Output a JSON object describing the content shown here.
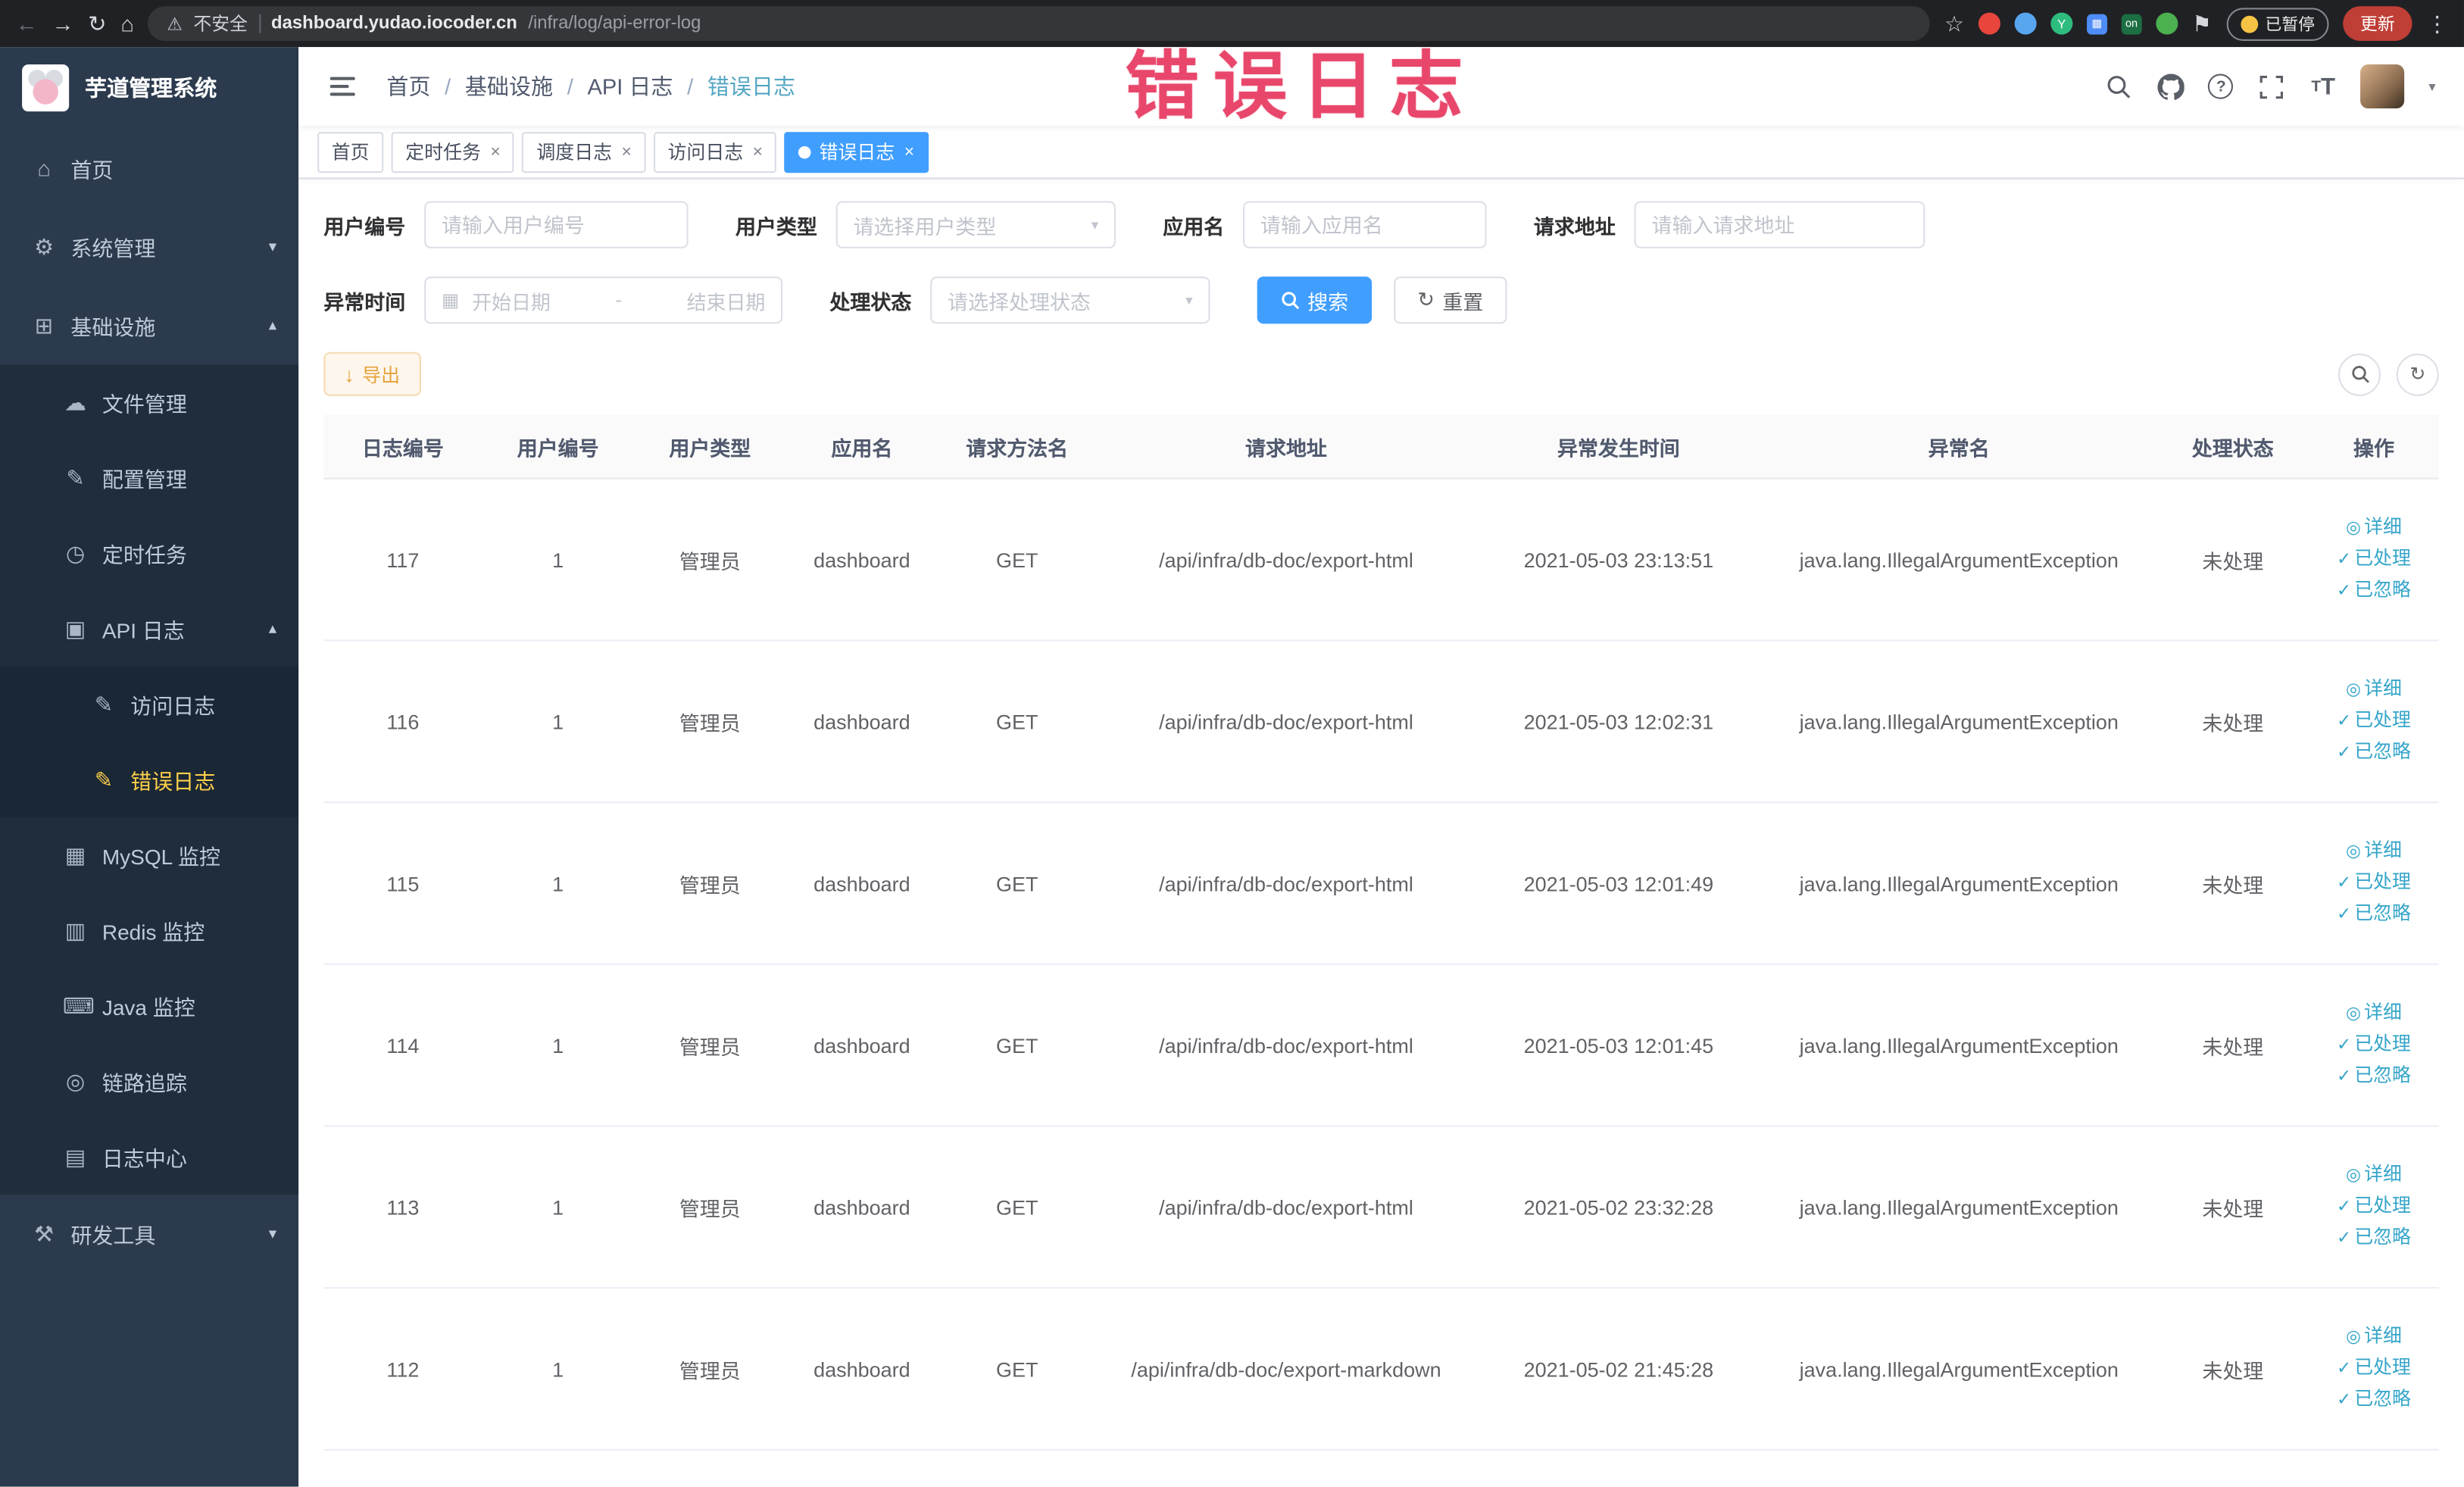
{
  "browser": {
    "security_label": "不安全",
    "url_host": "dashboard.yudao.iocoder.cn",
    "url_path": "/infra/log/api-error-log",
    "extension_on_badge": "on",
    "paused_badge": "已暂停",
    "update_label": "更新"
  },
  "annotation_text": "错误日志",
  "icons": {
    "back": "←",
    "forward": "→",
    "reload": "↻",
    "home_btn": "⌂",
    "warning": "⚠",
    "star": "☆",
    "more": "⋮",
    "close": "×",
    "caret": "▾",
    "home": "⌂",
    "system": "⚙",
    "infra": "⊞",
    "file": "☁",
    "config": "✎",
    "job": "◷",
    "api_log": "▣",
    "access_log": "✎",
    "error_log": "✎",
    "mysql": "▦",
    "redis": "▥",
    "java": "⌨",
    "trace": "◎",
    "log_center": "▤",
    "dev_tools": "⚒",
    "chevron_down": "▾",
    "chevron_up": "▴",
    "help": "?",
    "calendar": "▦",
    "reset": "↻",
    "download": "↓",
    "detail": "◎",
    "check": "✓"
  },
  "sidebar": {
    "logo_title": "芋道管理系统",
    "items": {
      "home": "首页",
      "system": "系统管理",
      "infra": "基础设施",
      "file": "文件管理",
      "config": "配置管理",
      "job": "定时任务",
      "api_log": "API 日志",
      "access_log": "访问日志",
      "error_log": "错误日志",
      "mysql": "MySQL 监控",
      "redis": "Redis 监控",
      "java": "Java 监控",
      "trace": "链路追踪",
      "log_center": "日志中心",
      "dev_tools": "研发工具"
    }
  },
  "breadcrumb": [
    "首页",
    "基础设施",
    "API 日志",
    "错误日志"
  ],
  "tabs": [
    {
      "label": "首页"
    },
    {
      "label": "定时任务"
    },
    {
      "label": "调度日志"
    },
    {
      "label": "访问日志"
    },
    {
      "label": "错误日志"
    }
  ],
  "filters": {
    "user_id_label": "用户编号",
    "user_id_placeholder": "请输入用户编号",
    "user_type_label": "用户类型",
    "user_type_placeholder": "请选择用户类型",
    "app_name_label": "应用名",
    "app_name_placeholder": "请输入应用名",
    "request_url_label": "请求地址",
    "request_url_placeholder": "请输入请求地址",
    "exception_time_label": "异常时间",
    "date_start_placeholder": "开始日期",
    "date_separator": "-",
    "date_end_placeholder": "结束日期",
    "process_status_label": "处理状态",
    "process_status_placeholder": "请选择处理状态",
    "search_label": "搜索",
    "reset_label": "重置"
  },
  "toolbar": {
    "export_label": "导出"
  },
  "table": {
    "columns": [
      "日志编号",
      "用户编号",
      "用户类型",
      "应用名",
      "请求方法名",
      "请求地址",
      "异常发生时间",
      "异常名",
      "处理状态",
      "操作"
    ],
    "actions": {
      "detail": "详细",
      "processed": "已处理",
      "ignored": "已忽略"
    },
    "rows": [
      {
        "id": "117",
        "user_id": "1",
        "user_type": "管理员",
        "app_name": "dashboard",
        "method": "GET",
        "url": "/api/infra/db-doc/export-html",
        "time": "2021-05-03 23:13:51",
        "exception": "java.lang.IllegalArgumentException",
        "status": "未处理"
      },
      {
        "id": "116",
        "user_id": "1",
        "user_type": "管理员",
        "app_name": "dashboard",
        "method": "GET",
        "url": "/api/infra/db-doc/export-html",
        "time": "2021-05-03 12:02:31",
        "exception": "java.lang.IllegalArgumentException",
        "status": "未处理"
      },
      {
        "id": "115",
        "user_id": "1",
        "user_type": "管理员",
        "app_name": "dashboard",
        "method": "GET",
        "url": "/api/infra/db-doc/export-html",
        "time": "2021-05-03 12:01:49",
        "exception": "java.lang.IllegalArgumentException",
        "status": "未处理"
      },
      {
        "id": "114",
        "user_id": "1",
        "user_type": "管理员",
        "app_name": "dashboard",
        "method": "GET",
        "url": "/api/infra/db-doc/export-html",
        "time": "2021-05-03 12:01:45",
        "exception": "java.lang.IllegalArgumentException",
        "status": "未处理"
      },
      {
        "id": "113",
        "user_id": "1",
        "user_type": "管理员",
        "app_name": "dashboard",
        "method": "GET",
        "url": "/api/infra/db-doc/export-html",
        "time": "2021-05-02 23:32:28",
        "exception": "java.lang.IllegalArgumentException",
        "status": "未处理"
      },
      {
        "id": "112",
        "user_id": "1",
        "user_type": "管理员",
        "app_name": "dashboard",
        "method": "GET",
        "url": "/api/infra/db-doc/export-markdown",
        "time": "2021-05-02 21:45:28",
        "exception": "java.lang.IllegalArgumentException",
        "status": "未处理"
      }
    ]
  },
  "colors": {
    "primary": "#409eff",
    "warning": "#e6a23c",
    "sidebar_active": "#ffd04b",
    "annotation": "#e8476b"
  }
}
